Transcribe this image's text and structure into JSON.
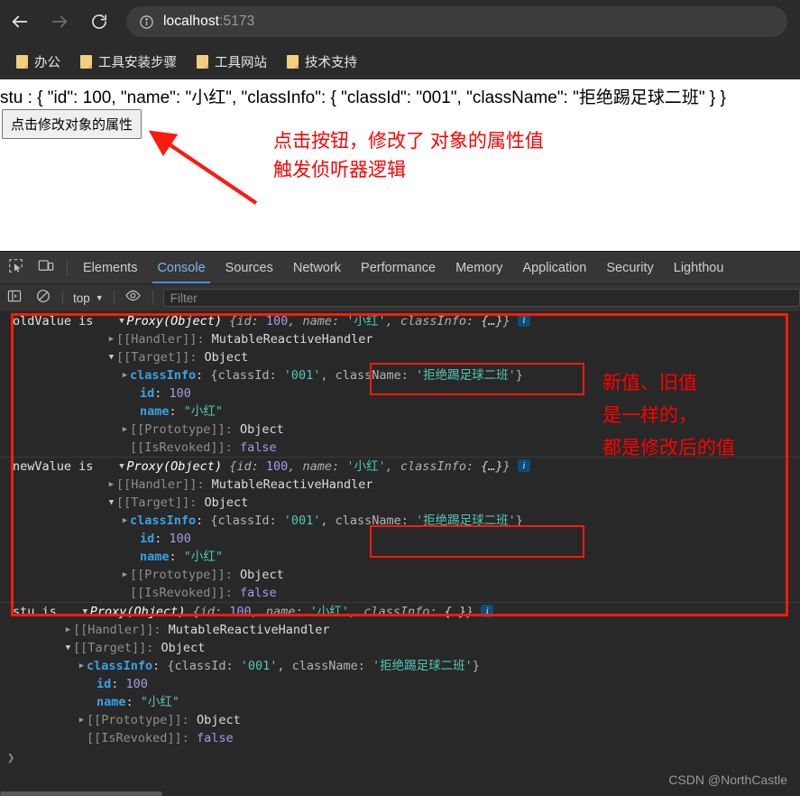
{
  "browser": {
    "back_icon": "back-arrow-icon",
    "forward_icon": "forward-arrow-icon",
    "reload_icon": "reload-icon",
    "site_info_icon": "info-circle-icon",
    "url_host": "localhost",
    "url_port": ":5173",
    "url_full": "localhost:5173",
    "bookmarks": [
      {
        "label": "办公"
      },
      {
        "label": "工具安装步骤"
      },
      {
        "label": "工具网站"
      },
      {
        "label": "技术支持"
      }
    ]
  },
  "page": {
    "output_line": "stu : { \"id\": 100, \"name\": \"小红\", \"classInfo\": { \"classId\": \"001\", \"className\": \"拒绝踢足球二班\" } }",
    "button_label": "点击修改对象的属性",
    "annotations": [
      {
        "line1": "点击按钮，修改了 对象的属性值",
        "line2": "触发侦听器逻辑"
      },
      {
        "line1": "新值、旧值",
        "line2": "是一样的，",
        "line3": "都是修改后的值"
      }
    ],
    "annotation_color": "#ff0000"
  },
  "devtools": {
    "inspect_icon": "inspect-element-icon",
    "device_icon": "device-toolbar-icon",
    "tabs": [
      {
        "label": "Elements",
        "active": false
      },
      {
        "label": "Console",
        "active": true
      },
      {
        "label": "Sources",
        "active": false
      },
      {
        "label": "Network",
        "active": false
      },
      {
        "label": "Performance",
        "active": false
      },
      {
        "label": "Memory",
        "active": false
      },
      {
        "label": "Application",
        "active": false
      },
      {
        "label": "Security",
        "active": false
      },
      {
        "label": "Lighthou",
        "active": false
      }
    ],
    "filterbar": {
      "sidebar_icon": "console-sidebar-icon",
      "clear_icon": "clear-console-icon",
      "context_value": "top",
      "context_caret": "▼",
      "eye_icon": "live-expression-eye-icon",
      "filter_placeholder": "Filter"
    },
    "accent_color": "#4e93d6",
    "highlight_color": "#fb1b0c",
    "prompt_symbol": "❯"
  },
  "console": {
    "messages": [
      {
        "label": "oldValue is",
        "head": {
          "triangle": "▼",
          "type": "Proxy(Object)",
          "preview_open": "{",
          "k1": "id",
          "v1": "100",
          "k2": "name",
          "v2": "'小红'",
          "k3": "classInfo",
          "v3": "{…}",
          "preview_close": "}",
          "info": "i"
        },
        "rows": [
          {
            "triangle": "▶",
            "key": "[[Handler]]",
            "sep": ":",
            "value": "MutableReactiveHandler",
            "kind": "internal"
          },
          {
            "triangle": "▼",
            "key": "[[Target]]",
            "sep": ":",
            "value": "Object",
            "kind": "internal"
          },
          {
            "triangle": "▶",
            "key": "classInfo",
            "sep": ":",
            "value_open": "{classId: ",
            "value_id": "'001'",
            "value_comma": ", ",
            "value_cn_key": "className: ",
            "value_cn": "'拒绝踢足球二班'",
            "value_close": "}",
            "kind": "own-object"
          },
          {
            "triangle": "",
            "key": "id",
            "sep": ":",
            "value": "100",
            "kind": "own-number"
          },
          {
            "triangle": "",
            "key": "name",
            "sep": ":",
            "value": "\"小红\"",
            "kind": "own-string"
          },
          {
            "triangle": "▶",
            "key": "[[Prototype]]",
            "sep": ":",
            "value": "Object",
            "kind": "internal"
          },
          {
            "triangle": "",
            "key": "[[IsRevoked]]",
            "sep": ":",
            "value": "false",
            "kind": "internal-bool"
          }
        ]
      },
      {
        "label": "newValue is",
        "head": {
          "triangle": "▼",
          "type": "Proxy(Object)",
          "preview_open": "{",
          "k1": "id",
          "v1": "100",
          "k2": "name",
          "v2": "'小红'",
          "k3": "classInfo",
          "v3": "{…}",
          "preview_close": "}",
          "info": "i"
        },
        "rows": [
          {
            "triangle": "▶",
            "key": "[[Handler]]",
            "sep": ":",
            "value": "MutableReactiveHandler",
            "kind": "internal"
          },
          {
            "triangle": "▼",
            "key": "[[Target]]",
            "sep": ":",
            "value": "Object",
            "kind": "internal"
          },
          {
            "triangle": "▶",
            "key": "classInfo",
            "sep": ":",
            "value_open": "{classId: ",
            "value_id": "'001'",
            "value_comma": ", ",
            "value_cn_key": "className: ",
            "value_cn": "'拒绝踢足球二班'",
            "value_close": "}",
            "kind": "own-object"
          },
          {
            "triangle": "",
            "key": "id",
            "sep": ":",
            "value": "100",
            "kind": "own-number"
          },
          {
            "triangle": "",
            "key": "name",
            "sep": ":",
            "value": "\"小红\"",
            "kind": "own-string"
          },
          {
            "triangle": "▶",
            "key": "[[Prototype]]",
            "sep": ":",
            "value": "Object",
            "kind": "internal"
          },
          {
            "triangle": "",
            "key": "[[IsRevoked]]",
            "sep": ":",
            "value": "false",
            "kind": "internal-bool"
          }
        ]
      },
      {
        "label": "stu is",
        "head": {
          "triangle": "▼",
          "type": "Proxy(Object)",
          "preview_open": "{",
          "k1": "id",
          "v1": "100",
          "k2": "name",
          "v2": "'小红'",
          "k3": "classInfo",
          "v3": "{…}",
          "preview_close": "}",
          "info": "i"
        },
        "rows": [
          {
            "triangle": "▶",
            "key": "[[Handler]]",
            "sep": ":",
            "value": "MutableReactiveHandler",
            "kind": "internal"
          },
          {
            "triangle": "▼",
            "key": "[[Target]]",
            "sep": ":",
            "value": "Object",
            "kind": "internal"
          },
          {
            "triangle": "▶",
            "key": "classInfo",
            "sep": ":",
            "value_open": "{classId: ",
            "value_id": "'001'",
            "value_comma": ", ",
            "value_cn_key": "className: ",
            "value_cn": "'拒绝踢足球二班'",
            "value_close": "}",
            "kind": "own-object"
          },
          {
            "triangle": "",
            "key": "id",
            "sep": ":",
            "value": "100",
            "kind": "own-number"
          },
          {
            "triangle": "",
            "key": "name",
            "sep": ":",
            "value": "\"小红\"",
            "kind": "own-string"
          },
          {
            "triangle": "▶",
            "key": "[[Prototype]]",
            "sep": ":",
            "value": "Object",
            "kind": "internal"
          },
          {
            "triangle": "",
            "key": "[[IsRevoked]]",
            "sep": ":",
            "value": "false",
            "kind": "internal-bool"
          }
        ]
      }
    ]
  },
  "watermark": "CSDN @NorthCastle"
}
